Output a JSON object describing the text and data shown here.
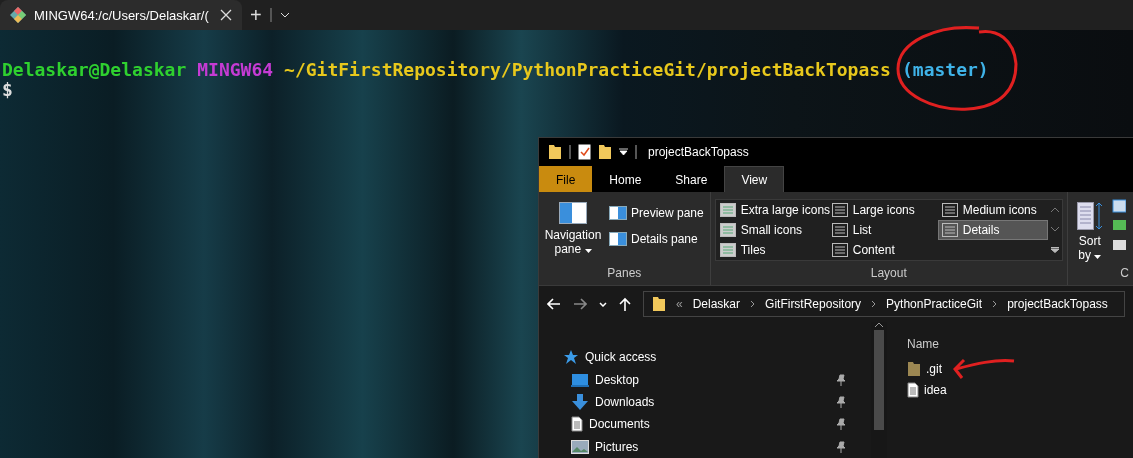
{
  "terminal": {
    "tabs": [
      {
        "title": "MINGW64:/c/Users/Delaskar/(",
        "selected": true
      }
    ],
    "new_tab": "+",
    "prompt": {
      "user": "Delaskar@Delaskar",
      "system": "MINGW64",
      "path": "~/GitFirstRepository/PythonPracticeGit/projectBackTopass",
      "branch": "(master)"
    },
    "cursor_line": "$"
  },
  "explorer": {
    "title": "projectBackTopass",
    "tabs": [
      {
        "label": "File",
        "selected": false,
        "kind": "file"
      },
      {
        "label": "Home",
        "selected": false,
        "kind": "tab"
      },
      {
        "label": "Share",
        "selected": false,
        "kind": "tab"
      },
      {
        "label": "View",
        "selected": true,
        "kind": "tab"
      }
    ],
    "ribbon": {
      "panes": {
        "label": "Panes",
        "navigation_pane": "Navigation pane",
        "items": [
          "Preview pane",
          "Details pane"
        ]
      },
      "layout": {
        "label": "Layout",
        "options": [
          {
            "label": "Extra large icons",
            "selected": false
          },
          {
            "label": "Large icons",
            "selected": false
          },
          {
            "label": "Medium icons",
            "selected": false
          },
          {
            "label": "Small icons",
            "selected": false
          },
          {
            "label": "List",
            "selected": false
          },
          {
            "label": "Details",
            "selected": true
          },
          {
            "label": "Tiles",
            "selected": false
          },
          {
            "label": "Content",
            "selected": false
          }
        ]
      },
      "sort_by": "Sort by",
      "group_3_label": "C"
    },
    "address": {
      "overflow": "«",
      "segments": [
        "Delaskar",
        "GitFirstRepository",
        "PythonPracticeGit",
        "projectBackTopass"
      ]
    },
    "navigation": [
      {
        "label": "Quick access",
        "kind": "star",
        "pinned": false
      },
      {
        "label": "Desktop",
        "kind": "desktop",
        "pinned": true
      },
      {
        "label": "Downloads",
        "kind": "download",
        "pinned": true
      },
      {
        "label": "Documents",
        "kind": "document",
        "pinned": true
      },
      {
        "label": "Pictures",
        "kind": "picture",
        "pinned": true
      }
    ],
    "files": {
      "column": "Name",
      "items": [
        {
          "name": ".git",
          "kind": "folder"
        },
        {
          "name": "idea",
          "kind": "file"
        }
      ]
    }
  }
}
